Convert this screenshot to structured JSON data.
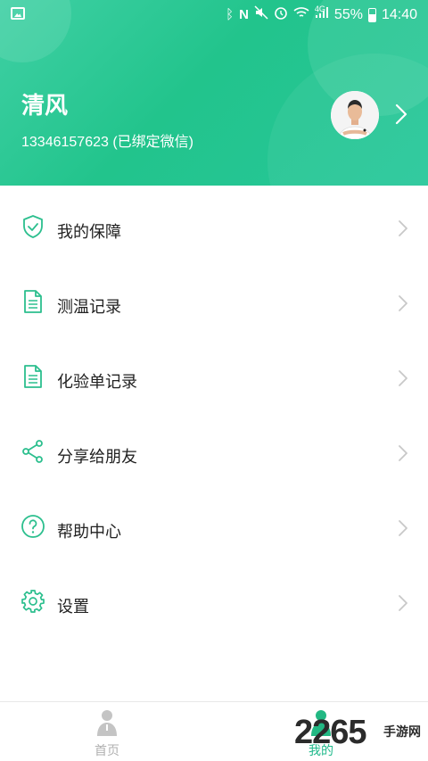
{
  "status_bar": {
    "battery_percent": "55%",
    "time": "14:40",
    "network": "4G",
    "icons": [
      "gallery-icon",
      "bluetooth-icon",
      "nfc-icon",
      "mute-icon",
      "alarm-icon",
      "wifi-icon",
      "signal-icon",
      "battery-icon"
    ]
  },
  "profile": {
    "name": "清风",
    "phone_line": "13346157623 (已绑定微信)"
  },
  "menu": {
    "items": [
      {
        "label": "我的保障",
        "icon": "shield-check-icon"
      },
      {
        "label": "测温记录",
        "icon": "document-icon"
      },
      {
        "label": "化验单记录",
        "icon": "document-icon"
      },
      {
        "label": "分享给朋友",
        "icon": "share-icon"
      },
      {
        "label": "帮助中心",
        "icon": "help-circle-icon"
      },
      {
        "label": "设置",
        "icon": "gear-icon"
      }
    ]
  },
  "tabbar": {
    "tabs": [
      {
        "label": "首页",
        "icon": "home-person-icon",
        "active": false
      },
      {
        "label": "我的",
        "icon": "person-icon",
        "active": true
      }
    ]
  },
  "watermark": {
    "number": "2265",
    "suffix": "手游网"
  },
  "colors": {
    "accent": "#22c48c",
    "icon_green": "#2cbf8e",
    "inactive_tab": "#b0b0b0",
    "text": "#222222",
    "chevron": "#c8c8c8"
  }
}
